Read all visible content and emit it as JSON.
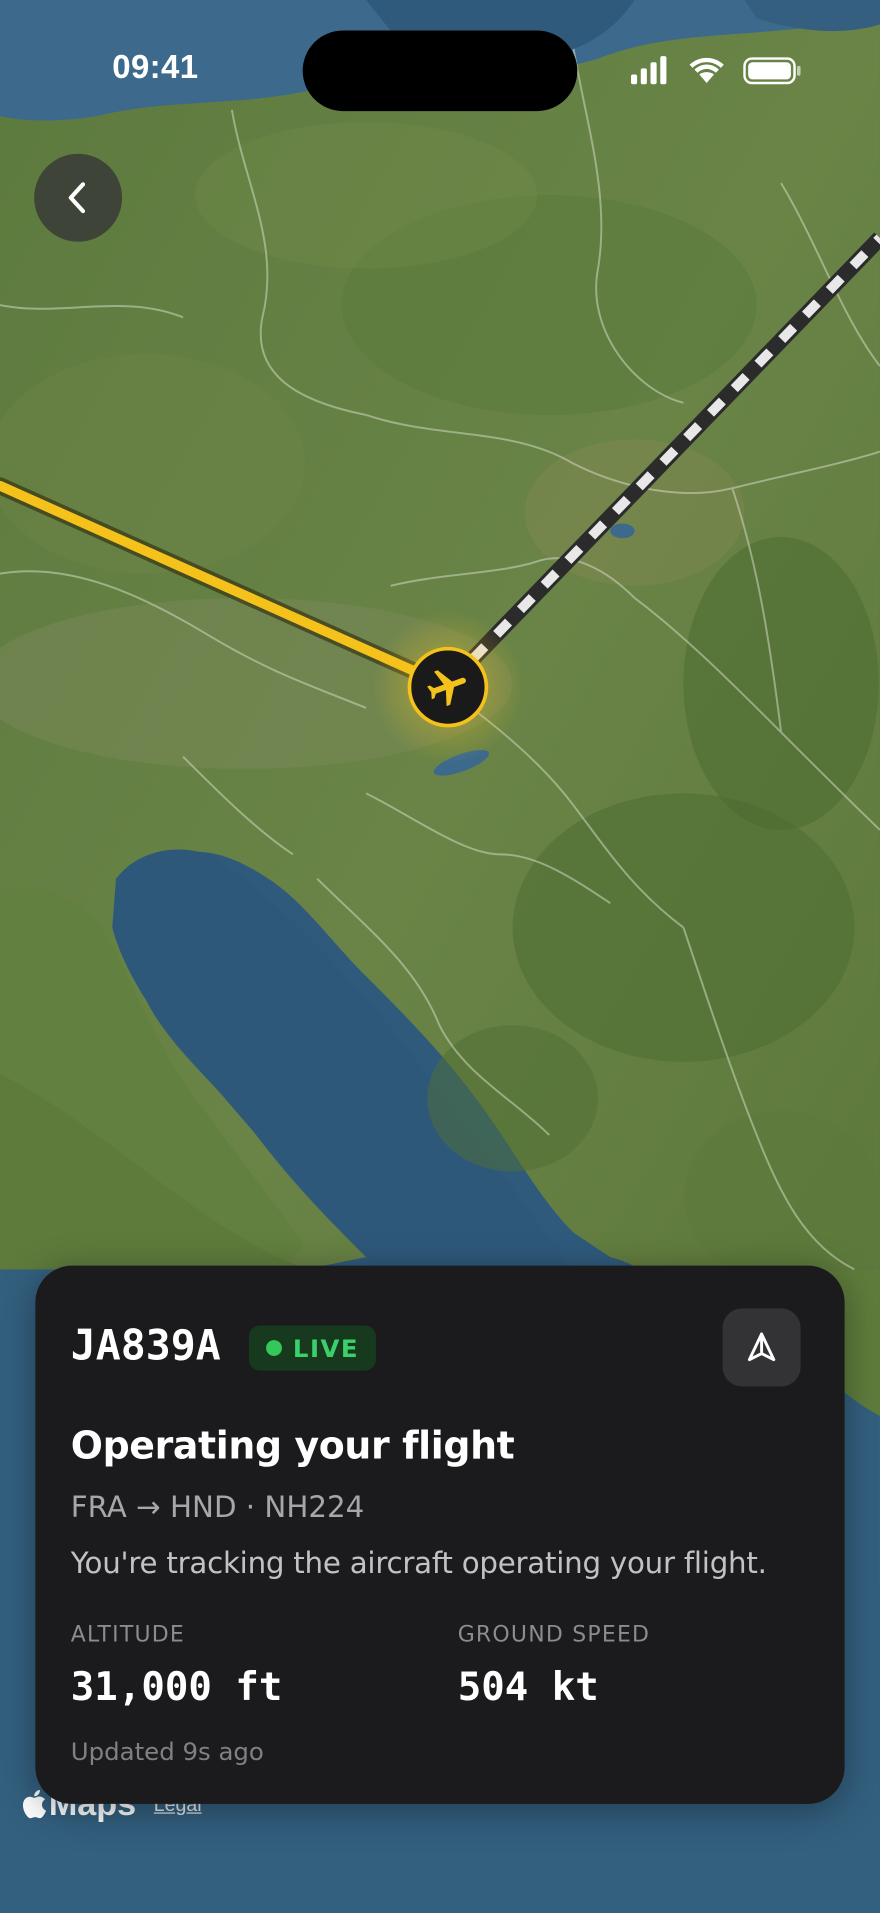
{
  "status_bar": {
    "time": "09:41",
    "icons": [
      "signal-icon",
      "wifi-icon",
      "battery-icon"
    ]
  },
  "map": {
    "flown_route_color": "#f5c21b",
    "planned_route_style": "dashed white/gray",
    "marker_icon": "airplane-icon",
    "attribution_brand": "Maps",
    "legal_link": "Legal"
  },
  "card": {
    "registration": "JA839A",
    "live_label": "LIVE",
    "live_color": "#34c759",
    "title": "Operating your flight",
    "route": "FRA → HND · NH224",
    "description": "You're tracking the aircraft operating your flight.",
    "stats": [
      {
        "label": "ALTITUDE",
        "value": "31,000 ft"
      },
      {
        "label": "GROUND SPEED",
        "value": "504 kt"
      }
    ],
    "updated": "Updated 9s ago"
  }
}
